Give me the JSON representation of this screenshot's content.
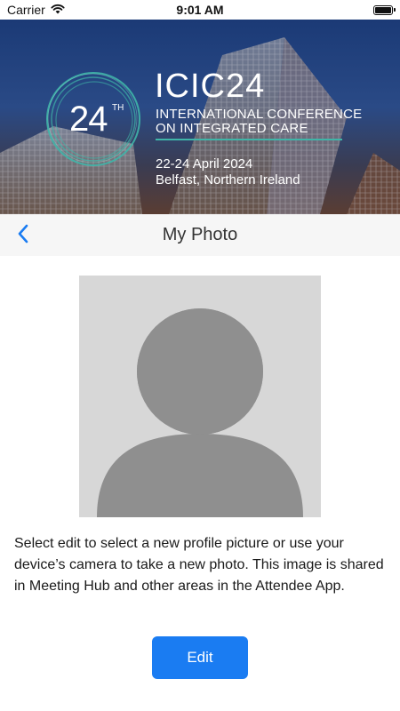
{
  "status_bar": {
    "carrier": "Carrier",
    "time": "9:01 AM",
    "icons": [
      "wifi-icon",
      "battery-icon"
    ]
  },
  "banner": {
    "edition_number": "24",
    "edition_suffix": "TH",
    "title": "ICIC24",
    "subtitle_line1": "INTERNATIONAL CONFERENCE",
    "subtitle_line2": "ON INTEGRATED CARE",
    "dates": "22-24 April 2024",
    "location": "Belfast, Northern Ireland",
    "accent_color": "#3fb5a8"
  },
  "nav": {
    "title": "My Photo",
    "back_icon": "chevron-left-icon",
    "accent_color": "#1a7cf2"
  },
  "content": {
    "avatar_icon": "default-avatar-placeholder",
    "description": "Select edit to select a new profile picture or use your device’s camera to take a new photo. This image is shared in Meeting Hub and other areas in the Attendee App.",
    "edit_label": "Edit"
  }
}
